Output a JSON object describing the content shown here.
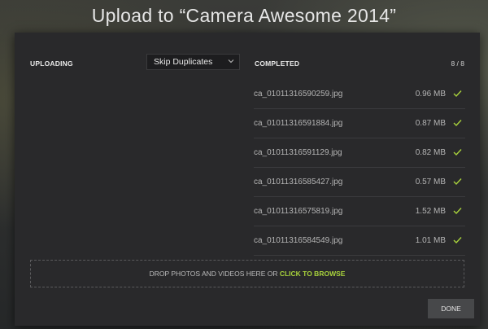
{
  "window": {
    "title": "Upload to “Camera Awesome 2014”"
  },
  "uploading": {
    "heading": "UPLOADING",
    "duplicate_select": {
      "value": "Skip Duplicates"
    }
  },
  "completed": {
    "heading": "COMPLETED",
    "count": "8 / 8",
    "files": [
      {
        "name": "ca_01011316590259.jpg",
        "size": "0.96 MB"
      },
      {
        "name": "ca_01011316591884.jpg",
        "size": "0.87 MB"
      },
      {
        "name": "ca_01011316591129.jpg",
        "size": "0.82 MB"
      },
      {
        "name": "ca_01011316585427.jpg",
        "size": "0.57 MB"
      },
      {
        "name": "ca_01011316575819.jpg",
        "size": "1.52 MB"
      },
      {
        "name": "ca_01011316584549.jpg",
        "size": "1.01 MB"
      }
    ]
  },
  "dropzone": {
    "text": "DROP PHOTOS AND VIDEOS HERE OR ",
    "browse_label": "CLICK TO BROWSE"
  },
  "footer": {
    "done_label": "DONE"
  },
  "colors": {
    "accent": "#a8d23c",
    "dialog_bg": "#29292b"
  }
}
